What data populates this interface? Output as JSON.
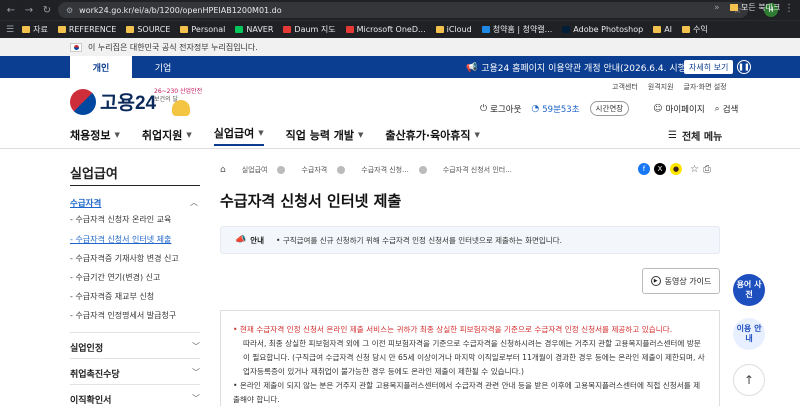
{
  "browser": {
    "url": "work24.go.kr/ei/a/b/1200/openHPEIAB1200M01.do",
    "profile_initial": "H",
    "bookmarks": [
      "자료",
      "REFERENCE",
      "SOURCE",
      "Personal",
      "NAVER",
      "Daum 지도",
      "Microsoft OneD...",
      "iCloud",
      "청약홈 | 청약캘...",
      "Adobe Photoshop",
      "AI",
      "수익"
    ],
    "bookmarks_all": "모든 북마크"
  },
  "gov_banner": "이 누리집은 대한민국 공식 전자정부 누리집입니다.",
  "top": {
    "tab_person": "개인",
    "tab_company": "기업",
    "notice": "고용24 홈페이지 이용약관 개정 안내(2026.6.4. 시행)",
    "notice_btn": "자세히 보기"
  },
  "header": {
    "logo": "고용24",
    "slogan_1": "26~230 산업안전",
    "slogan_2": "보건의 달",
    "util": [
      "고객센터",
      "원격지원",
      "글자·화면 설정"
    ],
    "logout": "로그아웃",
    "session_time": "59분53초",
    "extend": "시간연장",
    "mypage": "마이페이지",
    "search": "검색"
  },
  "nav": {
    "items": [
      "채용정보",
      "취업지원",
      "실업급여",
      "직업 능력 개발",
      "출산휴가·육아휴직"
    ],
    "all_menu": "전체 메뉴"
  },
  "sidebar": {
    "title": "실업급여",
    "category": "수급자격",
    "subs": [
      "수급자격 신청자 온라인 교육",
      "수급자격 신청서 인터넷 제출",
      "수급자격증 기재사항 변경 신고",
      "수급기간 연기(변경) 신고",
      "수급자격증 재교부 신청",
      "수급자격 인정명세서 발급청구"
    ],
    "groups": [
      "실업인정",
      "취업촉진수당",
      "이직확인서"
    ]
  },
  "breadcrumb": [
    "실업급여",
    "수급자격",
    "수급자격 신청...",
    "수급자격 신청서 인터..."
  ],
  "page_title": "수급자격 신청서 인터넷 제출",
  "guide": {
    "label": "안내",
    "text": "구직급여를 신규 신청하기 위해 수급자격 인정 신청서를 인터넷으로 제출하는 화면입니다."
  },
  "video_btn": "동영상 가이드",
  "info": {
    "warn": "현재 수급자격 인정 신청서 온라인 제출 서비스는 귀하가 최종 상실한 피보험자격을 기준으로 수급자격 인정 신청서를 제공하고 있습니다.",
    "p1": "따라서, 최종 상실한 피보험자격 외에 그 이전 피보험자격을 기준으로 수급자격을 신청하시려는 경우에는 거주지 관할 고용복지플러스센터에 방문이 필요합니다. (구직급여 수급자격 신청 당시 만 65세 이상이거나 마지막 이직일로부터 11개월이 경과한 경우 등에는 온라인 제출이 제한되며, 사업자등록증이 있거나 재취업이 불가능한 경우 등에도 온라인 제출이 제한될 수 있습니다.)",
    "p2": "온라인 제출이 되지 않는 분은 거주지 관할 고용복지플러스센터에서 수급자격 관련 안내 등을 받은 이후에 고용복지플러스센터에 직접 신청서를 제출해야 합니다."
  },
  "floating": {
    "dict": "용어 사전",
    "guide": "이용 안내"
  }
}
